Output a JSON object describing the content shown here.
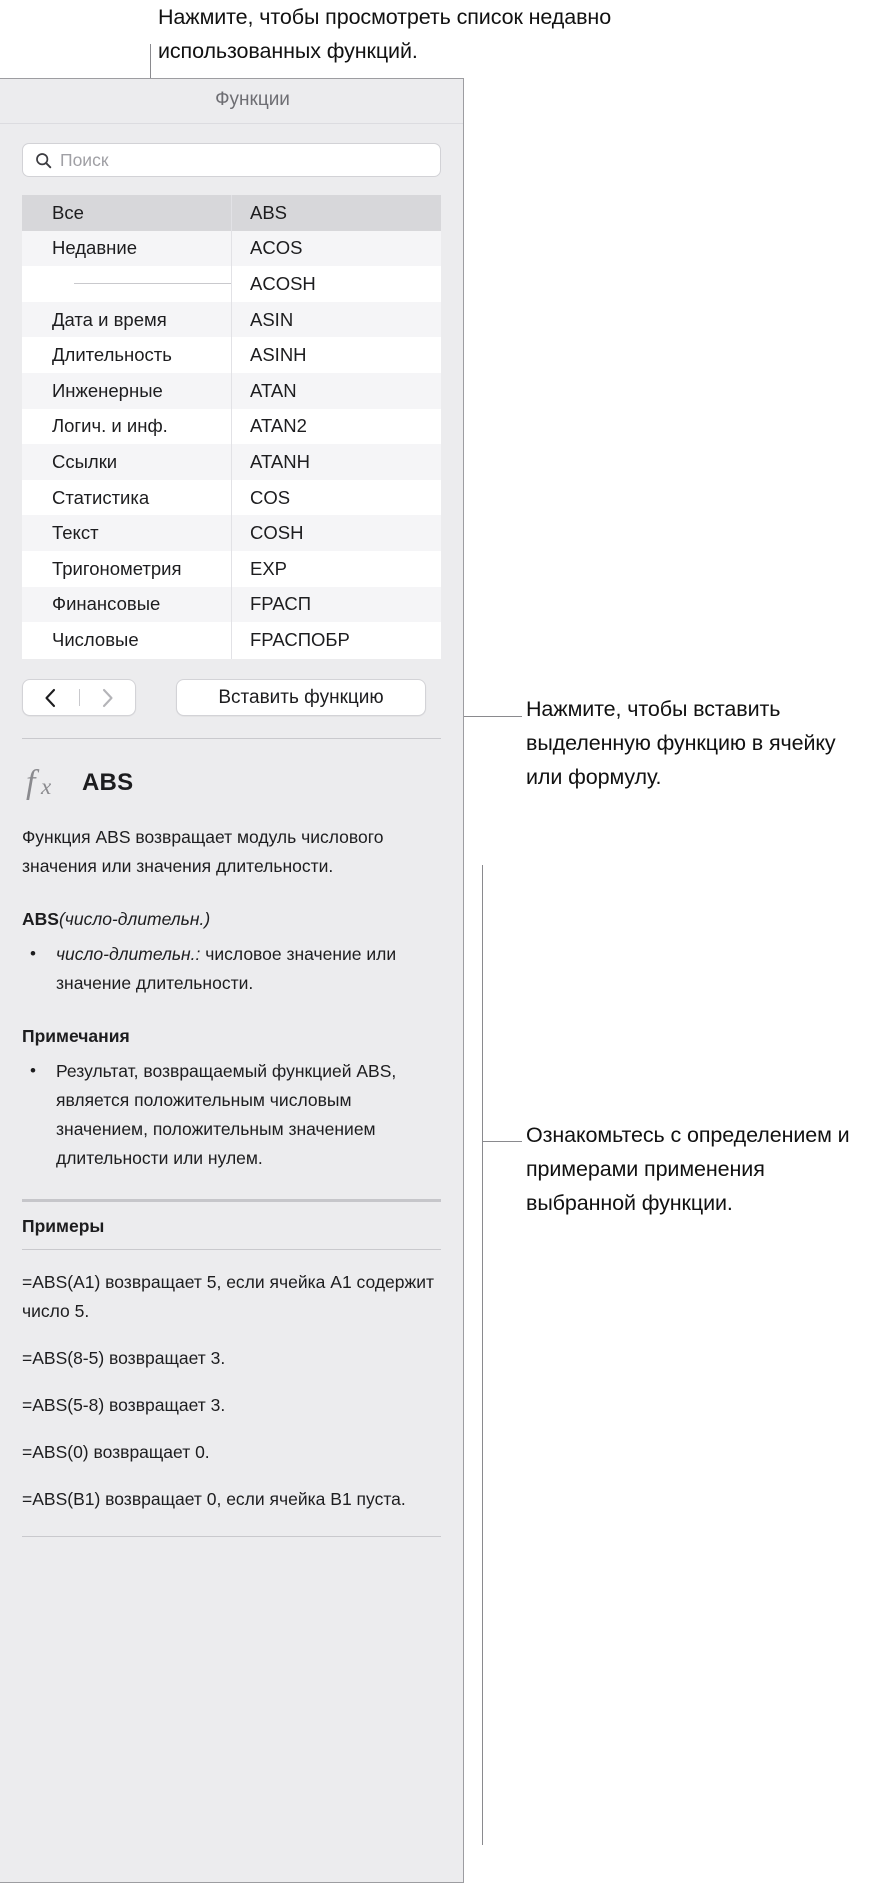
{
  "callouts": {
    "top": "Нажмите, чтобы просмотреть список недавно использованных функций.",
    "insert": "Нажмите, чтобы вставить выделенную функцию в ячейку или формулу.",
    "detail": "Ознакомьтесь с определением и примерами применения выбранной функции."
  },
  "panel": {
    "title": "Функции",
    "search": {
      "placeholder": "Поиск",
      "value": "",
      "icon": "search-icon"
    },
    "categories": [
      {
        "label": "Все",
        "selected": true
      },
      {
        "label": "Недавние",
        "selected": false
      },
      {
        "label": "",
        "separator": true
      },
      {
        "label": "Дата и время",
        "selected": false
      },
      {
        "label": "Длительность",
        "selected": false
      },
      {
        "label": "Инженерные",
        "selected": false
      },
      {
        "label": "Логич. и инф.",
        "selected": false
      },
      {
        "label": "Ссылки",
        "selected": false
      },
      {
        "label": "Статистика",
        "selected": false
      },
      {
        "label": "Текст",
        "selected": false
      },
      {
        "label": "Тригонометрия",
        "selected": false
      },
      {
        "label": "Финансовые",
        "selected": false
      },
      {
        "label": "Числовые",
        "selected": false
      }
    ],
    "functions": [
      {
        "label": "ABS",
        "selected": true
      },
      {
        "label": "ACOS",
        "selected": false
      },
      {
        "label": "ACOSH",
        "selected": false
      },
      {
        "label": "ASIN",
        "selected": false
      },
      {
        "label": "ASINH",
        "selected": false
      },
      {
        "label": "ATAN",
        "selected": false
      },
      {
        "label": "ATAN2",
        "selected": false
      },
      {
        "label": "ATANH",
        "selected": false
      },
      {
        "label": "COS",
        "selected": false
      },
      {
        "label": "COSH",
        "selected": false
      },
      {
        "label": "EXP",
        "selected": false
      },
      {
        "label": "FРАСП",
        "selected": false
      },
      {
        "label": "FРАСПОБР",
        "selected": false
      }
    ],
    "nav": {
      "back_icon": "chevron-left-icon",
      "forward_icon": "chevron-right-icon"
    },
    "insert_button": "Вставить функцию"
  },
  "detail": {
    "icon": "fx-icon",
    "name": "ABS",
    "description": "Функция ABS возвращает модуль числового значения или значения длительности.",
    "signature_name": "ABS",
    "signature_args": "(число-длительн.)",
    "argument_bullets": [
      {
        "term": "число-длительн.:",
        "text": " числовое значение или значение длительности."
      }
    ],
    "notes_heading": "Примечания",
    "notes": [
      "Результат, возвращаемый функцией ABS, является положительным числовым значением, положительным значением длительности или нулем."
    ],
    "examples_heading": "Примеры",
    "examples": [
      "=ABS(A1) возвращает 5, если ячейка A1 содержит число 5.",
      "=ABS(8-5) возвращает 3.",
      "=ABS(5-8) возвращает 3.",
      "=ABS(0) возвращает 0.",
      "=ABS(B1) возвращает 0, если ячейка B1 пуста."
    ]
  }
}
